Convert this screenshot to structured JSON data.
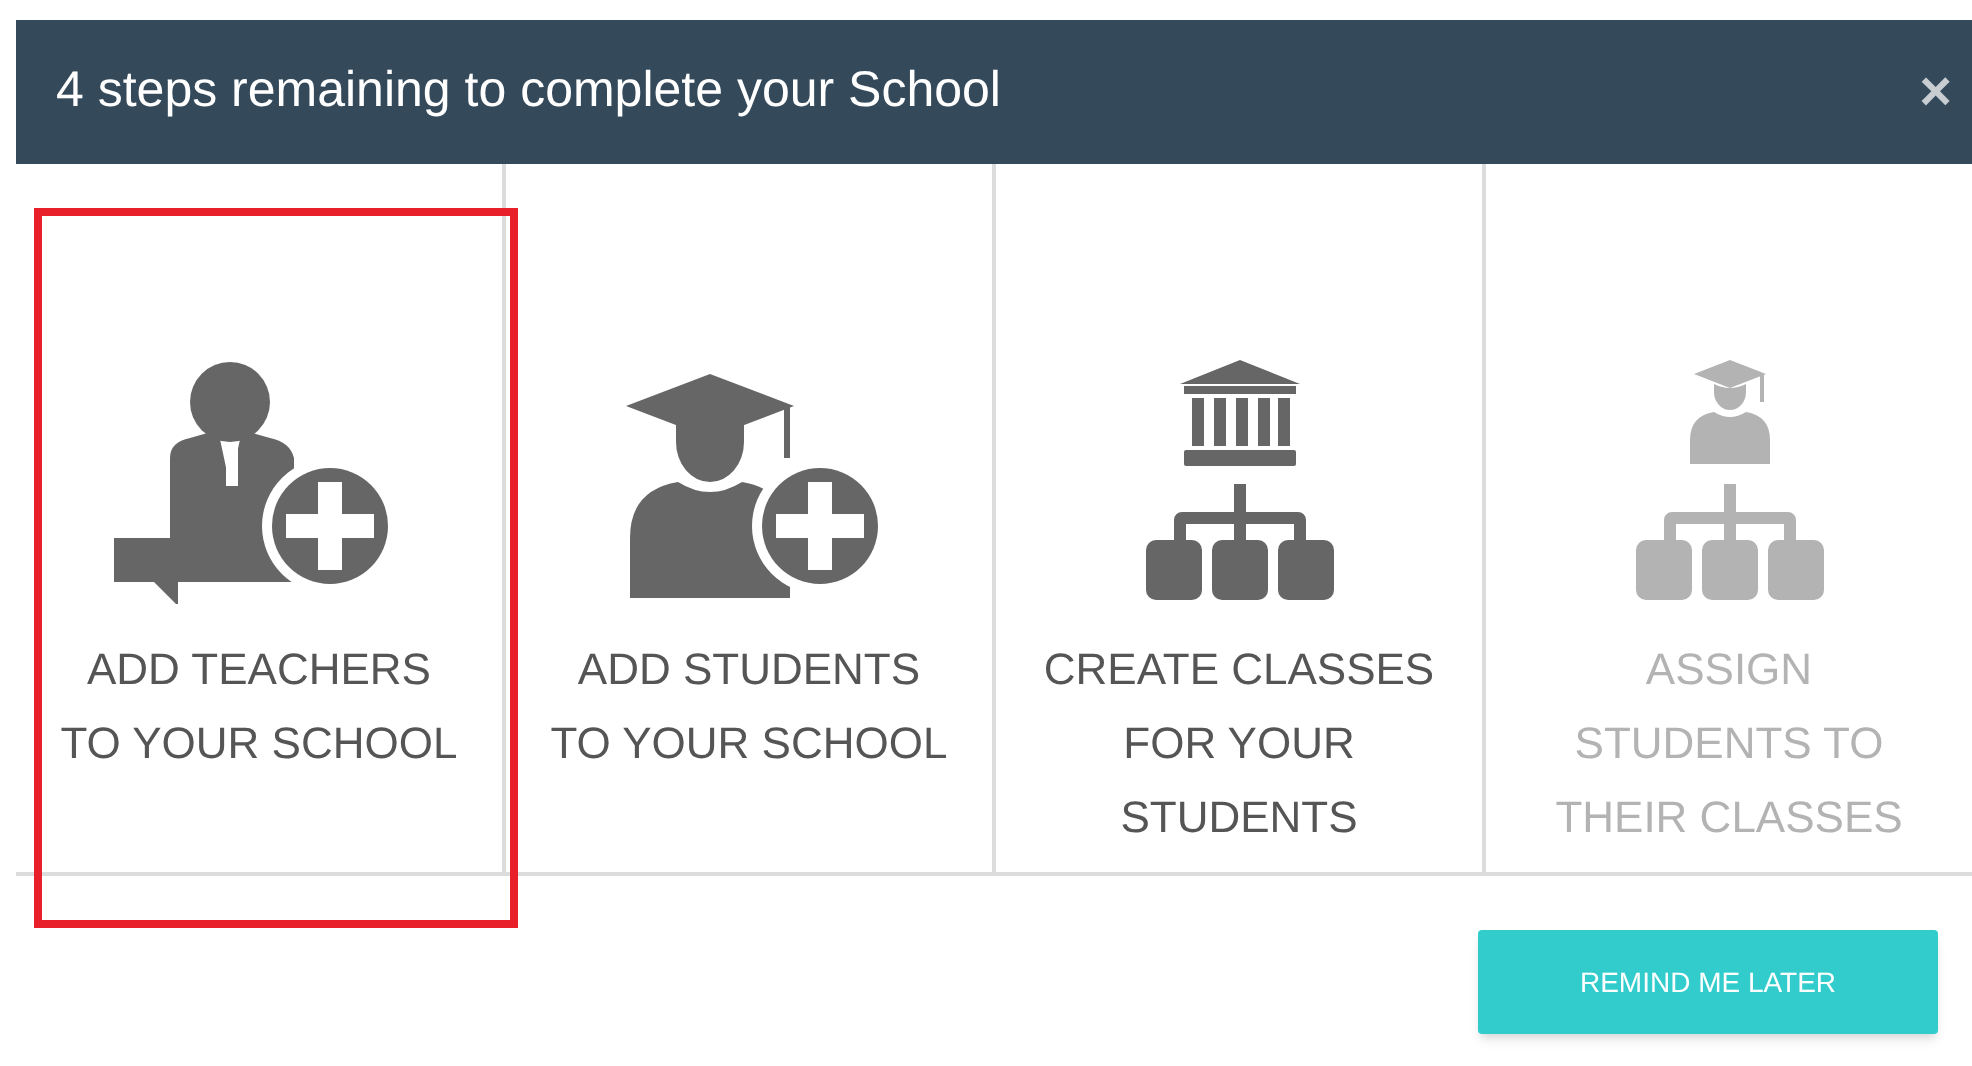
{
  "header": {
    "title": "4 steps remaining to complete your School",
    "close": "×"
  },
  "steps": [
    {
      "kind": "teacher-add",
      "lines": [
        "ADD TEACHERS",
        "TO YOUR SCHOOL"
      ],
      "disabled": false,
      "highlighted": true
    },
    {
      "kind": "student-add",
      "lines": [
        "ADD STUDENTS",
        "TO YOUR SCHOOL"
      ],
      "disabled": false,
      "highlighted": false
    },
    {
      "kind": "class-tree",
      "lines": [
        "CREATE CLASSES",
        "FOR YOUR",
        "STUDENTS"
      ],
      "disabled": false,
      "highlighted": false
    },
    {
      "kind": "student-tree",
      "lines": [
        "ASSIGN",
        "STUDENTS TO",
        "THEIR CLASSES"
      ],
      "disabled": true,
      "highlighted": false
    }
  ],
  "button": "REMIND ME LATER"
}
